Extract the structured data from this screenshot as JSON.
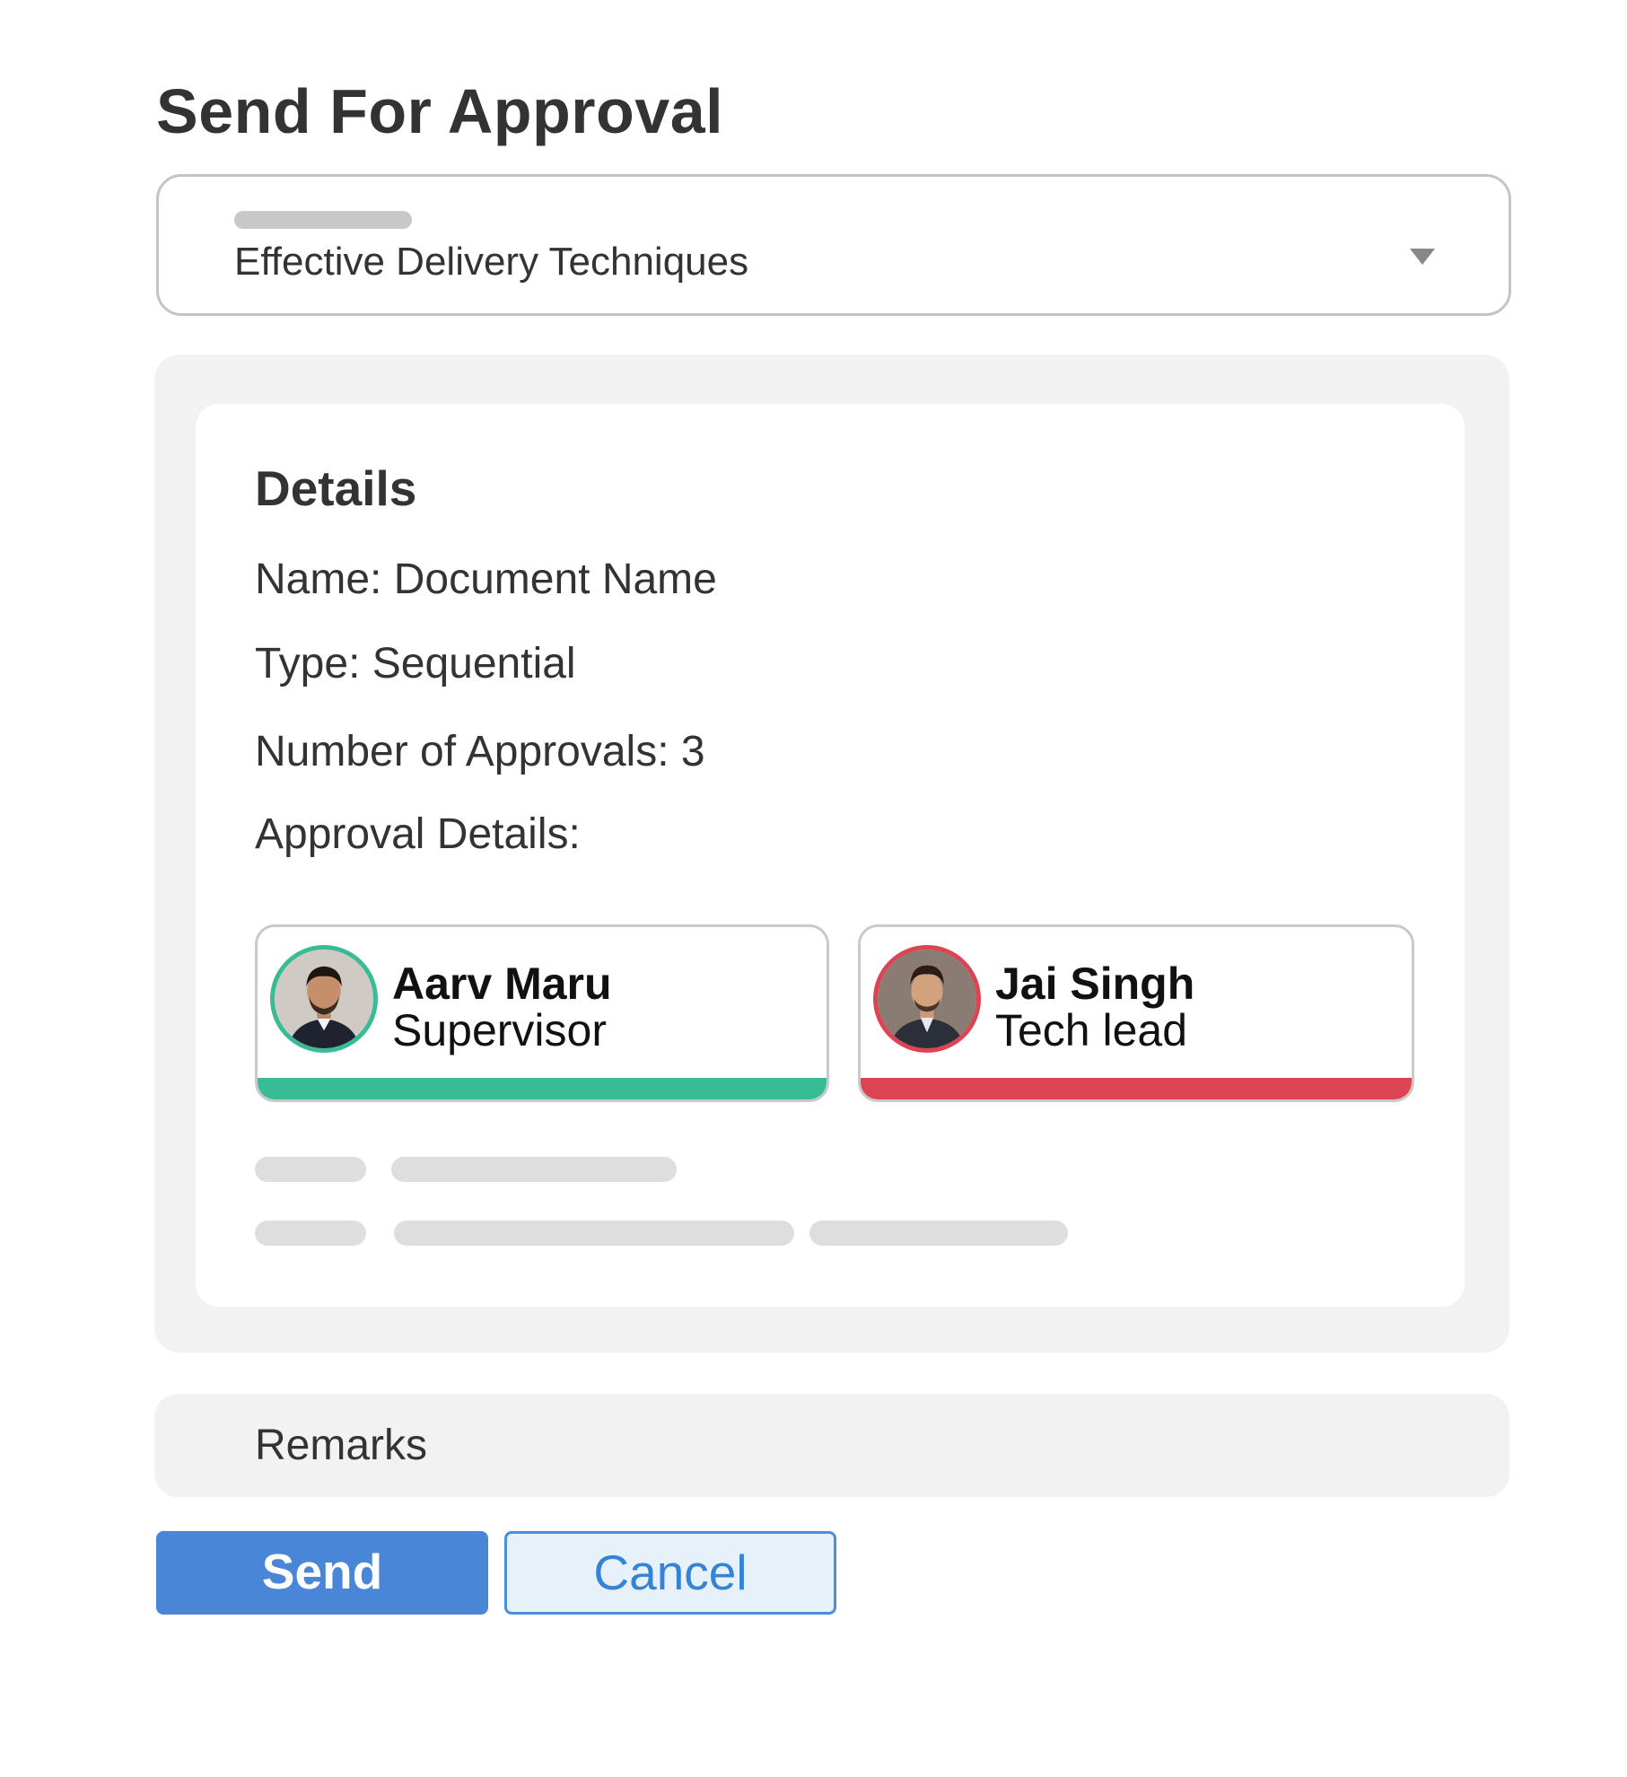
{
  "page": {
    "title": "Send For Approval"
  },
  "template_select": {
    "value": "Effective Delivery Techniques",
    "icon": "chevron-down-icon"
  },
  "details": {
    "heading": "Details",
    "name_line": "Name: Document Name",
    "type_line": "Type: Sequential",
    "count_line": "Number of Approvals: 3",
    "approval_details_label": "Approval Details:"
  },
  "approvers": [
    {
      "name": "Aarv Maru",
      "role": "Supervisor",
      "status_color": "#38bc96"
    },
    {
      "name": "Jai Singh",
      "role": "Tech lead",
      "status_color": "#dc4453"
    }
  ],
  "remarks": {
    "placeholder": "Remarks"
  },
  "actions": {
    "send_label": "Send",
    "cancel_label": "Cancel"
  },
  "colors": {
    "primary": "#4a86d8",
    "approved": "#38bc96",
    "rejected": "#dc4453"
  }
}
